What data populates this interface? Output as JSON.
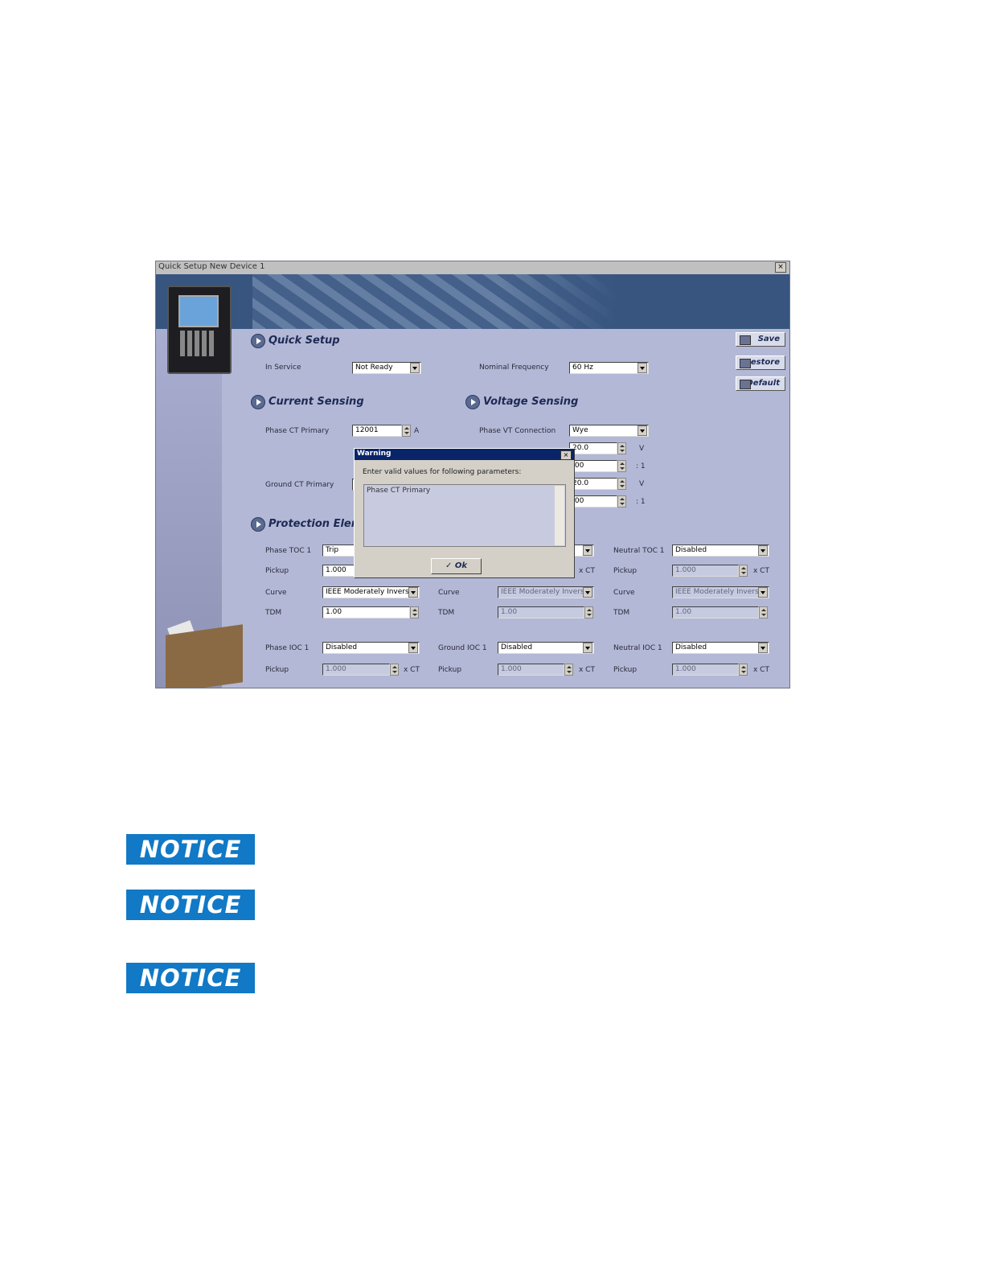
{
  "window": {
    "title": "Quick Setup    New Device 1",
    "close": "×"
  },
  "sections": {
    "quick_setup": "Quick Setup",
    "current_sensing": "Current Sensing",
    "voltage_sensing": "Voltage Sensing",
    "protection": "Protection Eleme"
  },
  "buttons": {
    "save": "Save",
    "restore": "Restore",
    "default": "Default"
  },
  "quick": {
    "in_service_label": "In Service",
    "in_service_value": "Not Ready",
    "nominal_frequency_label": "Nominal Frequency",
    "nominal_frequency_value": "60 Hz"
  },
  "current": {
    "phase_ct_primary_label": "Phase CT Primary",
    "phase_ct_primary_value": "12001",
    "phase_ct_unit": "A",
    "ground_ct_primary_label": "Ground CT Primary"
  },
  "voltage": {
    "phase_vt_connection_label": "Phase VT Connection",
    "phase_vt_connection_value": "Wye",
    "rows": [
      {
        "value": "20.0",
        "unit": "V"
      },
      {
        "value": ".00",
        "unit": ": 1"
      },
      {
        "value": "20.0",
        "unit": "V"
      },
      {
        "value": ".00",
        "unit": ": 1"
      }
    ]
  },
  "protection": {
    "col1": {
      "toc_label": "Phase TOC 1",
      "toc_value": "Trip",
      "pickup_label": "Pickup",
      "pickup_value": "1.000",
      "curve_label": "Curve",
      "curve_value": "IEEE Moderately Inverse",
      "tdm_label": "TDM",
      "tdm_value": "1.00",
      "ioc_label": "Phase IOC 1",
      "ioc_value": "Disabled",
      "ioc_pickup_label": "Pickup",
      "ioc_pickup_value": "1.000",
      "ioc_unit": "x CT"
    },
    "col2": {
      "pickup_unit": "x CT",
      "curve_label": "Curve",
      "curve_value": "IEEE Moderately Inverse",
      "tdm_label": "TDM",
      "tdm_value": "1.00",
      "ioc_label": "Ground IOC 1",
      "ioc_value": "Disabled",
      "ioc_pickup_label": "Pickup",
      "ioc_pickup_value": "1.000",
      "ioc_unit": "x CT"
    },
    "col3": {
      "toc_label": "Neutral TOC 1",
      "toc_value": "Disabled",
      "pickup_label": "Pickup",
      "pickup_value": "1.000",
      "pickup_unit": "x CT",
      "curve_label": "Curve",
      "curve_value": "IEEE Moderately Inverse",
      "tdm_label": "TDM",
      "tdm_value": "1.00",
      "ioc_label": "Neutral IOC 1",
      "ioc_value": "Disabled",
      "ioc_pickup_label": "Pickup",
      "ioc_pickup_value": "1.000",
      "ioc_unit": "x CT"
    }
  },
  "dialog": {
    "title": "Warning",
    "close": "×",
    "message": "Enter valid values for following parameters:",
    "items": [
      "Phase CT Primary"
    ],
    "ok": "Ok"
  },
  "notices": [
    "NOTICE",
    "NOTICE",
    "NOTICE"
  ]
}
